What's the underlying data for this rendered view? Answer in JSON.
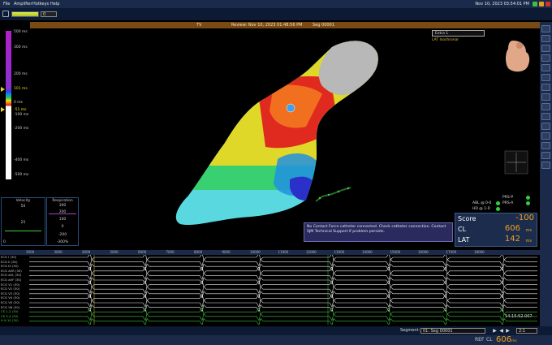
{
  "menu": [
    "File",
    "Amplifier",
    "Hotkeys",
    "Help"
  ],
  "clock": "Nov 10, 2023 03:54:01 PM",
  "toolbar": {
    "select_value": "0"
  },
  "header": {
    "view": "TV",
    "review": "Review: Nov 10, 2023 01:48:56 PM",
    "segment": "Seg 00001"
  },
  "scale": {
    "labels": [
      "500 ms",
      "300 ms",
      "200 ms",
      "101 ms",
      "0 ms",
      "-51 ms",
      "-100 ms",
      "-200 ms",
      "-400 ms",
      "-500 ms"
    ],
    "colors": {
      "purple": "#b020c8",
      "red": "#e02020",
      "yellow": "#e0e020",
      "green": "#30c060",
      "blue": "#4040e0"
    }
  },
  "extra": {
    "value": "Extra 1",
    "subtitle": "LAT Isochronal"
  },
  "velocity": {
    "title": "Velocity",
    "values": [
      "50",
      "25",
      "0"
    ]
  },
  "respiration": {
    "title": "Respiration",
    "values": [
      "300",
      "200",
      "100",
      "0",
      "-200",
      "-300%"
    ]
  },
  "catheters": [
    {
      "label": "ABL @ 0-0",
      "right": "PRS-P",
      "color": "#2fd040"
    },
    {
      "label": "HD @ 1-0",
      "right": "PRS-A",
      "color": "#2fd040"
    }
  ],
  "score": {
    "score_label": "Score",
    "score_value": "-100",
    "cl_label": "CL",
    "cl_value": "606",
    "cl_unit": "ms",
    "lat_label": "LAT",
    "lat_value": "142",
    "lat_unit": "ms"
  },
  "warning": "No Contact Force catheter connected. Check catheter connection. Contact SJM Technical Support if problem persists.",
  "ecg": {
    "ruler": [
      "2000",
      "3000",
      "4000",
      "5000",
      "6000",
      "7000",
      "8000",
      "9000",
      "10000",
      "11000",
      "12000",
      "13000",
      "14000",
      "15000",
      "16000",
      "17000",
      "18000"
    ],
    "leads": [
      "ECG I (30)",
      "ECG II (30)",
      "ECG III (30)",
      "ECG aVR (30)",
      "ECG aVL (30)",
      "ECG aVF (30)",
      "ECG V1 (30)",
      "ECG V2 (30)",
      "ECG V3 (30)",
      "ECG V4 (30)",
      "ECG V5 (30)",
      "ECG V6 (30)",
      "CS 1-2 (30)",
      "CS 3-4 (30)",
      "H 9-10 (30)"
    ],
    "time": "14:15:52.007"
  },
  "bottom": {
    "segment_label": "Segment:",
    "segment_value": "01: Seg 00001",
    "speed_value": "2:1"
  },
  "status": {
    "ref": "REF",
    "cl_label": "CL",
    "cl_value": "606",
    "cl_unit": "ms"
  }
}
